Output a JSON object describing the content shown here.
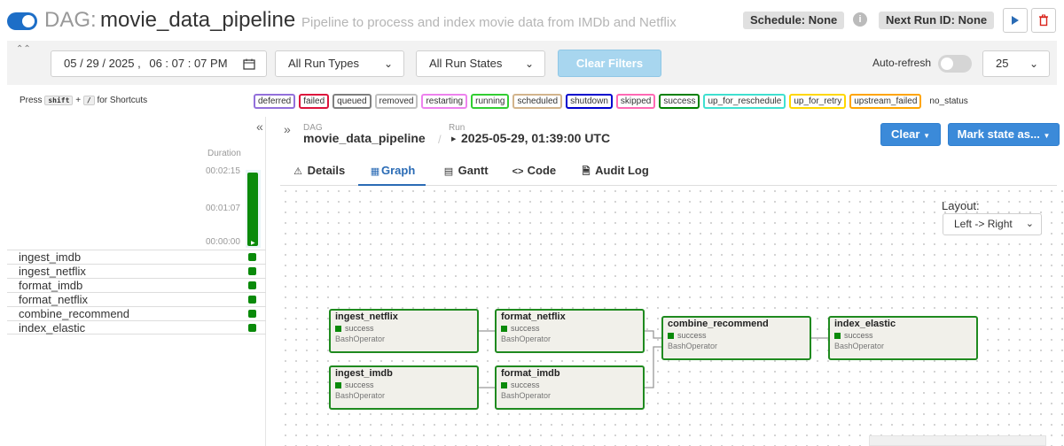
{
  "header": {
    "dag_prefix": "DAG:",
    "dag_id": "movie_data_pipeline",
    "description": "Pipeline to process and index movie data from IMDb and Netflix",
    "schedule": "Schedule: None",
    "next_run": "Next Run ID: None",
    "toggle_on": true
  },
  "filters": {
    "date": "05 / 29 / 2025 ,",
    "time": "06 : 07 : 07   PM",
    "run_types": "All Run Types",
    "run_states": "All Run States",
    "clear_filters": "Clear Filters",
    "auto_refresh_label": "Auto-refresh",
    "auto_refresh_on": false,
    "page_size": "25"
  },
  "shortcuts": {
    "press": "Press",
    "key_shift": "shift",
    "plus": "+",
    "key_slash": "/",
    "suffix": "for Shortcuts"
  },
  "legend": [
    {
      "label": "deferred",
      "color": "#9370db"
    },
    {
      "label": "failed",
      "color": "#dc143c"
    },
    {
      "label": "queued",
      "color": "#808080"
    },
    {
      "label": "removed",
      "color": "#c0c0c0"
    },
    {
      "label": "restarting",
      "color": "#ee82ee"
    },
    {
      "label": "running",
      "color": "#32cd32"
    },
    {
      "label": "scheduled",
      "color": "#d2b48c"
    },
    {
      "label": "shutdown",
      "color": "#0000cd"
    },
    {
      "label": "skipped",
      "color": "#ff69b4"
    },
    {
      "label": "success",
      "color": "#008000"
    },
    {
      "label": "up_for_reschedule",
      "color": "#40e0d0"
    },
    {
      "label": "up_for_retry",
      "color": "#ffd700"
    },
    {
      "label": "upstream_failed",
      "color": "#ffa500"
    },
    {
      "label": "no_status",
      "color": ""
    }
  ],
  "grid": {
    "duration_label": "Duration",
    "ticks": [
      "00:02:15",
      "00:01:07",
      "00:00:00"
    ],
    "run_duration_fraction": 1.0,
    "tasks": [
      "ingest_imdb",
      "ingest_netflix",
      "format_imdb",
      "format_netflix",
      "combine_recommend",
      "index_elastic"
    ]
  },
  "breadcrumb": {
    "dag_label": "DAG",
    "dag_value": "movie_data_pipeline",
    "run_label": "Run",
    "run_value": "2025-05-29, 01:39:00 UTC"
  },
  "actions": {
    "clear": "Clear",
    "mark_state": "Mark state as..."
  },
  "tabs": [
    {
      "label": "Details",
      "icon": "warning-icon"
    },
    {
      "label": "Graph",
      "icon": "graph-icon"
    },
    {
      "label": "Gantt",
      "icon": "gantt-icon"
    },
    {
      "label": "Code",
      "icon": "code-icon"
    },
    {
      "label": "Audit Log",
      "icon": "audit-log-icon"
    }
  ],
  "active_tab": "Graph",
  "graph": {
    "layout_label": "Layout:",
    "layout_value": "Left -> Right",
    "nodes": [
      {
        "id": "ingest_netflix",
        "state": "success",
        "operator": "BashOperator"
      },
      {
        "id": "format_netflix",
        "state": "success",
        "operator": "BashOperator"
      },
      {
        "id": "combine_recommend",
        "state": "success",
        "operator": "BashOperator"
      },
      {
        "id": "index_elastic",
        "state": "success",
        "operator": "BashOperator"
      },
      {
        "id": "ingest_imdb",
        "state": "success",
        "operator": "BashOperator"
      },
      {
        "id": "format_imdb",
        "state": "success",
        "operator": "BashOperator"
      }
    ]
  },
  "colors": {
    "primary": "#3b8ad9",
    "success": "#0a8a0a",
    "node_border": "#1f8a1f",
    "node_bg": "#f1f0ea"
  }
}
